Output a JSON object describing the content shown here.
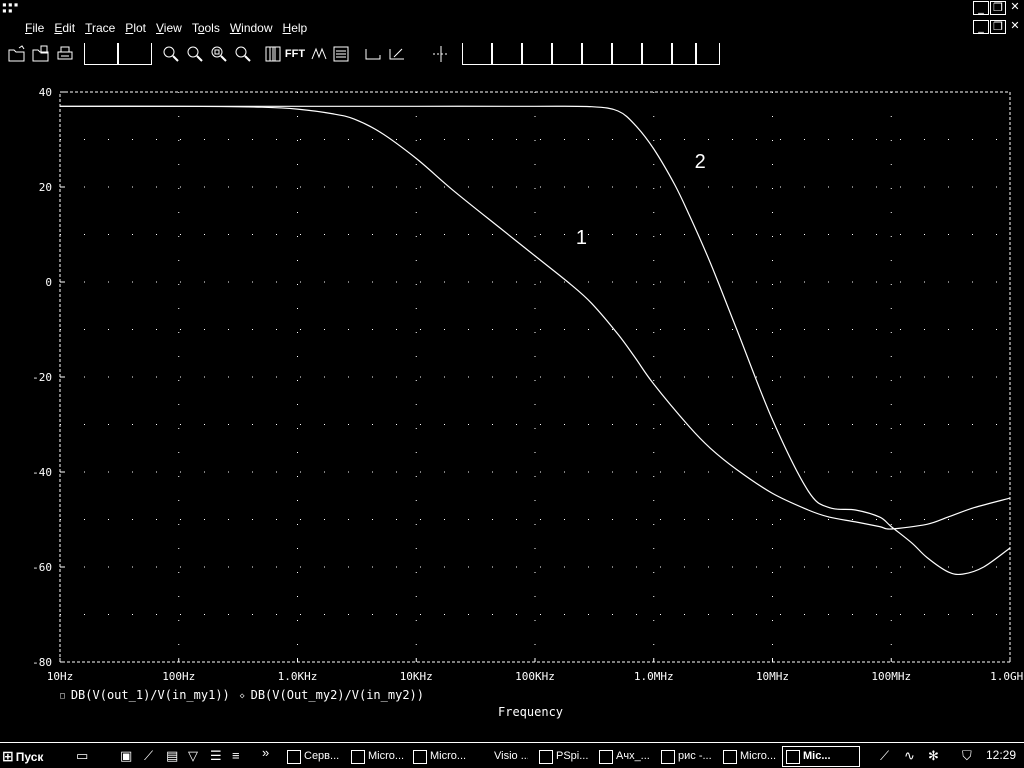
{
  "menu": {
    "items": [
      "File",
      "Edit",
      "Trace",
      "Plot",
      "View",
      "Tools",
      "Window",
      "Help"
    ],
    "underline": [
      "F",
      "E",
      "T",
      "P",
      "V",
      "o",
      "W",
      "H"
    ]
  },
  "window_controls": {
    "minimize": "_",
    "restore": "🗗",
    "close": "✕"
  },
  "toolbar": {
    "icons": [
      "open-folder-icon",
      "open-file-icon",
      "print-icon",
      "zoom-in-icon",
      "zoom-out-icon",
      "zoom-area-icon",
      "zoom-fit-icon",
      "log-x-axis-icon",
      "fft-icon",
      "performance-analysis-icon",
      "add-trace-icon",
      "plot-axis-icon",
      "plot-label-icon",
      "cursor-icon"
    ],
    "fft_label": "FFT"
  },
  "chart_data": {
    "type": "line",
    "xlabel": "Frequency",
    "ylabel": "",
    "xscale": "log",
    "xlim": [
      10,
      1000000000
    ],
    "ylim": [
      -80,
      40
    ],
    "grid": true,
    "x_tick_labels": [
      "10Hz",
      "100Hz",
      "1.0KHz",
      "10KHz",
      "100KHz",
      "1.0MHz",
      "10MHz",
      "100MHz",
      "1.0GHz"
    ],
    "x_ticks": [
      10,
      100,
      1000,
      10000,
      100000,
      1000000,
      10000000,
      100000000,
      1000000000
    ],
    "y_tick_labels": [
      "40",
      "20",
      "0",
      "-20",
      "-40",
      "-60",
      "-80"
    ],
    "y_ticks": [
      40,
      20,
      0,
      -20,
      -40,
      -60,
      -80
    ],
    "series": [
      {
        "name": "DB(V(out_1)/V(in_my1))",
        "marker": "□",
        "curve_label": "1",
        "label_at": [
          150000,
          8
        ],
        "x": [
          10,
          100,
          500,
          1000,
          2000,
          3000,
          5000,
          10000,
          20000,
          50000,
          100000,
          200000,
          300000,
          500000,
          700000,
          1000000,
          2000000,
          3000000,
          5000000,
          10000000,
          20000000,
          30000000,
          50000000,
          80000000,
          100000000,
          200000000,
          300000000,
          500000000,
          1000000000
        ],
        "y": [
          37,
          37,
          36.8,
          36.4,
          35.4,
          34.3,
          31.5,
          26,
          19.5,
          11.5,
          5.5,
          -0.5,
          -4.5,
          -11,
          -16,
          -21.5,
          -30.5,
          -35,
          -39.5,
          -44.5,
          -48,
          -49.5,
          -50.5,
          -51.5,
          -52,
          -51,
          -49.5,
          -47.5,
          -45.5
        ]
      },
      {
        "name": "DB(V(Out_my2)/V(in_my2))",
        "marker": "◇",
        "curve_label": "2",
        "label_at": [
          1500000,
          24
        ],
        "x": [
          10,
          100,
          1000,
          10000,
          100000,
          300000,
          500000,
          700000,
          1000000,
          1500000,
          2000000,
          3000000,
          5000000,
          10000000,
          20000000,
          30000000,
          50000000,
          80000000,
          100000000,
          150000000,
          200000000,
          300000000,
          400000000,
          600000000,
          1000000000
        ],
        "y": [
          37,
          37,
          37,
          37,
          37,
          36.9,
          36,
          33,
          28,
          20.5,
          14,
          4,
          -10,
          -29,
          -44,
          -47.5,
          -48,
          -49.5,
          -51.5,
          -55,
          -58,
          -61,
          -61.5,
          -60,
          -56
        ]
      }
    ]
  },
  "taskbar": {
    "start_label": "Пуск",
    "tasks": [
      "Серв...",
      "Micro...",
      "Micro...",
      "Visio ...",
      "PSpi...",
      "Ачх_...",
      "рис -...",
      "Micro...",
      "Mic..."
    ],
    "active_task_index": 8,
    "clock": "12:29"
  }
}
